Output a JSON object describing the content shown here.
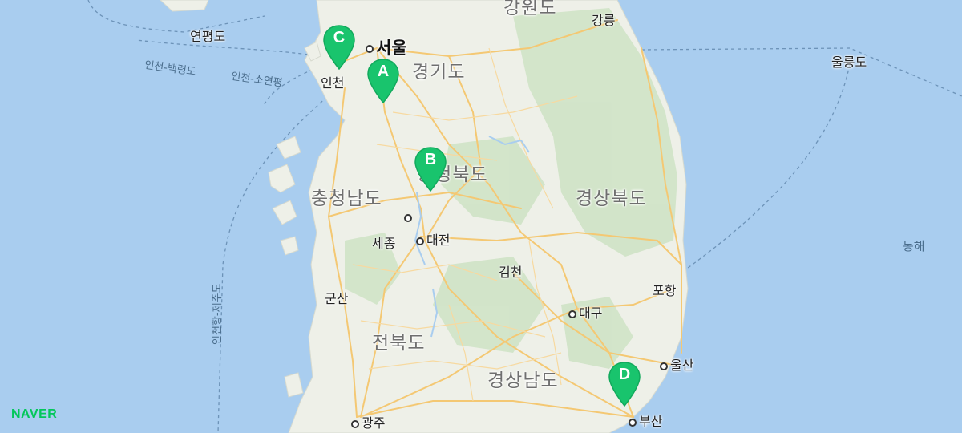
{
  "map": {
    "provider_logo": "NAVER",
    "colors": {
      "sea": "#a9cdef",
      "land": "#eef0e8",
      "forest": "#cfe3c6",
      "road": "#f5c46e",
      "marker": "#19c46d"
    },
    "regions": [
      "강원도",
      "경기도",
      "충청북도",
      "충청남도",
      "경상북도",
      "전북도",
      "경상남도"
    ],
    "capital": "서울",
    "cities": [
      "강릉",
      "인천",
      "세종",
      "대전",
      "김천",
      "대구",
      "포항",
      "울산",
      "부산",
      "광주",
      "군산"
    ],
    "islands": [
      "연평도",
      "울릉도"
    ],
    "sea_names": [
      "동해"
    ],
    "ferry_routes": [
      "인천-백령도",
      "인천-소연평",
      "인천항-제주도"
    ],
    "markers": [
      "A",
      "B",
      "C",
      "D"
    ]
  }
}
